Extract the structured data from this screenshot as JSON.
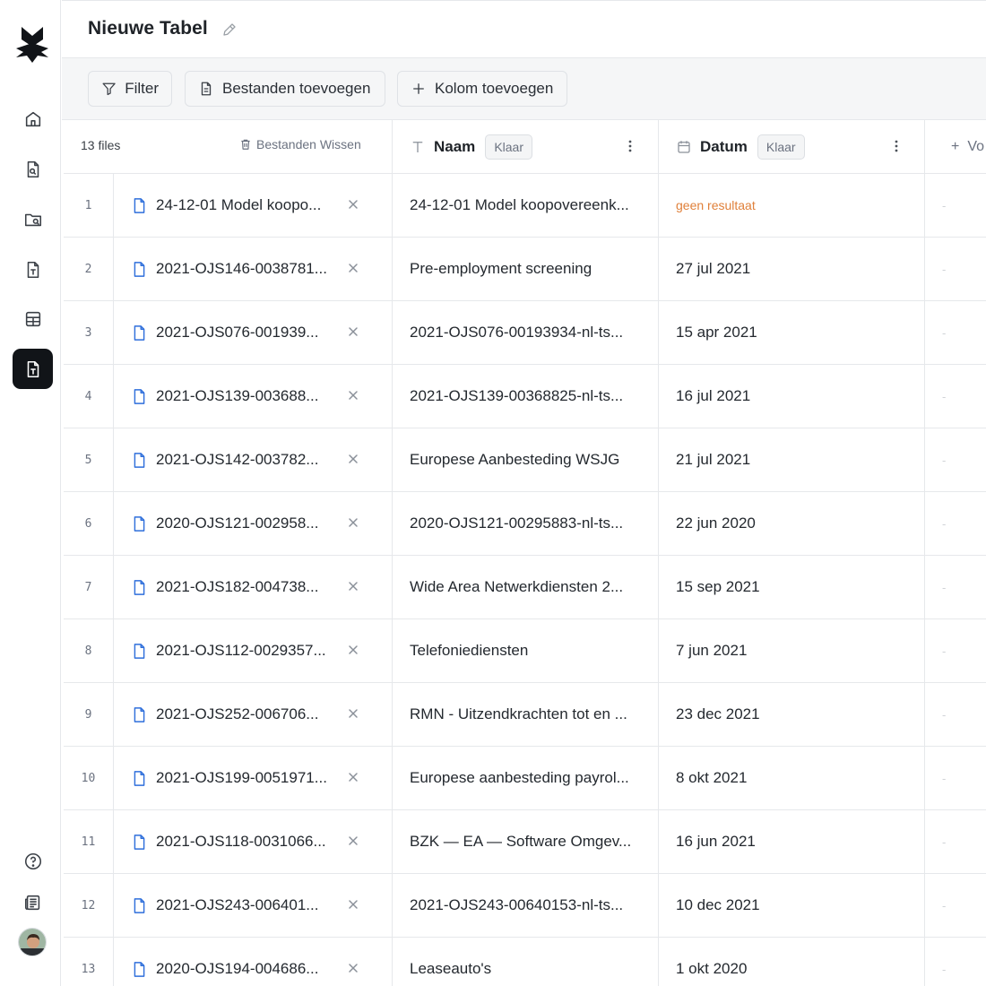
{
  "header": {
    "title": "Nieuwe Tabel"
  },
  "toolbar": {
    "filter_label": "Filter",
    "add_files_label": "Bestanden toevoegen",
    "add_column_label": "Kolom toevoegen"
  },
  "table": {
    "files_count": "13 files",
    "clear_files_label": "Bestanden Wissen",
    "columns": [
      {
        "name": "Naam",
        "status": "Klaar",
        "icon": "text-type-icon"
      },
      {
        "name": "Datum",
        "status": "Klaar",
        "icon": "calendar-icon"
      }
    ],
    "add_column_partial": "Vo",
    "empty_cell": "-",
    "rows": [
      {
        "n": "1",
        "file": "24-12-01 Model koopo...",
        "naam": "24-12-01 Model koopovereenk...",
        "datum": "geen resultaat",
        "warn": true
      },
      {
        "n": "2",
        "file": "2021-OJS146-0038781...",
        "naam": "Pre-employment screening",
        "datum": "27 jul 2021"
      },
      {
        "n": "3",
        "file": "2021-OJS076-001939...",
        "naam": "2021-OJS076-00193934-nl-ts...",
        "datum": "15 apr 2021"
      },
      {
        "n": "4",
        "file": "2021-OJS139-003688...",
        "naam": "2021-OJS139-00368825-nl-ts...",
        "datum": "16 jul 2021"
      },
      {
        "n": "5",
        "file": "2021-OJS142-003782...",
        "naam": "Europese Aanbesteding WSJG",
        "datum": "21 jul 2021"
      },
      {
        "n": "6",
        "file": "2020-OJS121-002958...",
        "naam": "2020-OJS121-00295883-nl-ts...",
        "datum": "22 jun 2020"
      },
      {
        "n": "7",
        "file": "2021-OJS182-004738...",
        "naam": "Wide Area Netwerkdiensten 2...",
        "datum": "15 sep 2021"
      },
      {
        "n": "8",
        "file": "2021-OJS112-0029357...",
        "naam": "Telefoniediensten",
        "datum": "7 jun 2021"
      },
      {
        "n": "9",
        "file": "2021-OJS252-006706...",
        "naam": "RMN - Uitzendkrachten tot en ...",
        "datum": "23 dec 2021"
      },
      {
        "n": "10",
        "file": "2021-OJS199-0051971...",
        "naam": "Europese aanbesteding payrol...",
        "datum": "8 okt 2021"
      },
      {
        "n": "11",
        "file": "2021-OJS118-0031066...",
        "naam": "BZK — EA — Software Omgev...",
        "datum": "16 jun 2021"
      },
      {
        "n": "12",
        "file": "2021-OJS243-006401...",
        "naam": "2021-OJS243-00640153-nl-ts...",
        "datum": "10 dec 2021"
      },
      {
        "n": "13",
        "file": "2020-OJS194-004686...",
        "naam": "Leaseauto's",
        "datum": "1 okt 2020"
      }
    ]
  }
}
